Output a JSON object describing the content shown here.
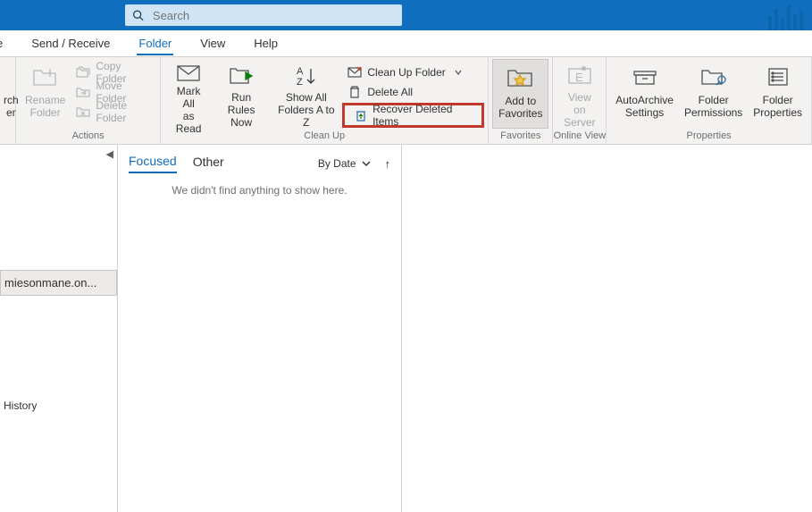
{
  "title_bar": {
    "search_placeholder": "Search"
  },
  "tabs": {
    "cut_left": "e",
    "send_receive": "Send / Receive",
    "folder": "Folder",
    "view": "View",
    "help": "Help",
    "active": "Folder"
  },
  "ribbon": {
    "groups": {
      "new_partial": {
        "label1": "rch",
        "label2": "er"
      },
      "actions": {
        "caption": "Actions",
        "rename": {
          "line1": "Rename",
          "line2": "Folder"
        },
        "copy": "Copy Folder",
        "move": "Move Folder",
        "delete": "Delete Folder"
      },
      "cleanup": {
        "caption": "Clean Up",
        "mark_all": {
          "line1": "Mark All",
          "line2": "as Read"
        },
        "run_rules": {
          "line1": "Run Rules",
          "line2": "Now"
        },
        "show_all": {
          "line1": "Show All",
          "line2": "Folders A to Z"
        },
        "cleanup_folder": "Clean Up Folder",
        "delete_all": "Delete All",
        "recover": "Recover Deleted Items"
      },
      "favorites": {
        "caption": "Favorites",
        "add": {
          "line1": "Add to",
          "line2": "Favorites"
        }
      },
      "online": {
        "caption": "Online View",
        "view_on": {
          "line1": "View on",
          "line2": "Server"
        }
      },
      "properties": {
        "caption": "Properties",
        "autoarchive": {
          "line1": "AutoArchive",
          "line2": "Settings"
        },
        "permissions": {
          "line1": "Folder",
          "line2": "Permissions"
        },
        "folder_props": {
          "line1": "Folder",
          "line2": "Properties"
        }
      }
    }
  },
  "folder_pane": {
    "account": "miesonmane.on...",
    "history": "History"
  },
  "list_pane": {
    "tabs": {
      "focused": "Focused",
      "other": "Other"
    },
    "sort_label": "By Date",
    "empty": "We didn't find anything to show here."
  }
}
